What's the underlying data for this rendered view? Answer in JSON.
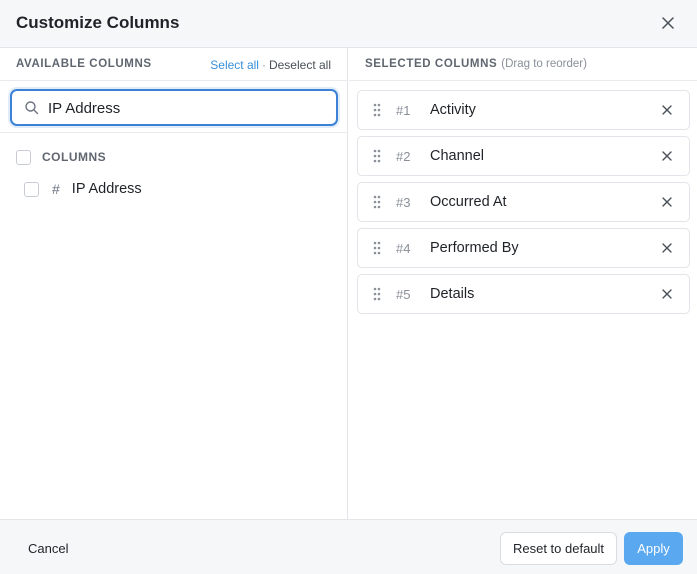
{
  "dialog": {
    "title": "Customize Columns",
    "close_icon": "close-icon"
  },
  "available": {
    "section_title": "AVAILABLE COLUMNS",
    "select_all_label": "Select all",
    "separator": "·",
    "deselect_all_label": "Deselect all",
    "search": {
      "value": "IP Address",
      "icon": "search-icon"
    },
    "group": {
      "label": "COLUMNS",
      "checked": false
    },
    "columns": [
      {
        "type_glyph": "#",
        "label": "IP Address",
        "checked": false
      }
    ]
  },
  "selected": {
    "section_title": "SELECTED COLUMNS",
    "hint": "(Drag to reorder)",
    "items": [
      {
        "num": "#1",
        "label": "Activity"
      },
      {
        "num": "#2",
        "label": "Channel"
      },
      {
        "num": "#3",
        "label": "Occurred At"
      },
      {
        "num": "#4",
        "label": "Performed By"
      },
      {
        "num": "#5",
        "label": "Details"
      }
    ]
  },
  "footer": {
    "cancel_label": "Cancel",
    "reset_label": "Reset to default",
    "apply_label": "Apply"
  },
  "colors": {
    "accent": "#3b82d6",
    "apply_button": "#5aa8f0",
    "link": "#3b8fd9"
  }
}
